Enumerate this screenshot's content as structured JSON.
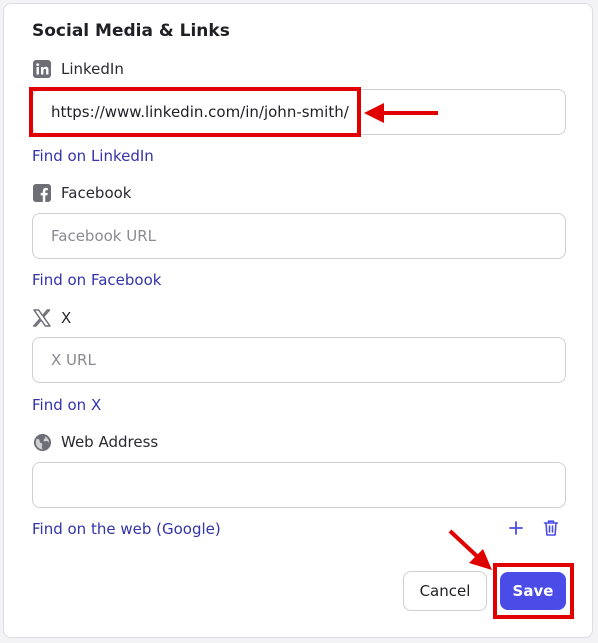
{
  "section": {
    "title": "Social Media & Links"
  },
  "linkedin": {
    "label": "LinkedIn",
    "value": "https://www.linkedin.com/in/john-smith/",
    "placeholder": "",
    "link": "Find on LinkedIn",
    "icon": "linkedin-icon"
  },
  "facebook": {
    "label": "Facebook",
    "value": "",
    "placeholder": "Facebook URL",
    "link": "Find on Facebook",
    "icon": "facebook-icon"
  },
  "x": {
    "label": "X",
    "value": "",
    "placeholder": "X URL",
    "link": "Find on X",
    "icon": "x-icon"
  },
  "web": {
    "label": "Web Address",
    "value": "",
    "placeholder": "",
    "link": "Find on the web (Google)",
    "icon": "globe-icon"
  },
  "actions": {
    "cancel": "Cancel",
    "save": "Save",
    "add_icon": "plus-icon",
    "delete_icon": "trash-icon"
  },
  "colors": {
    "accent": "#4b4be8",
    "link": "#3333aa",
    "annotation_red": "#e00000"
  }
}
